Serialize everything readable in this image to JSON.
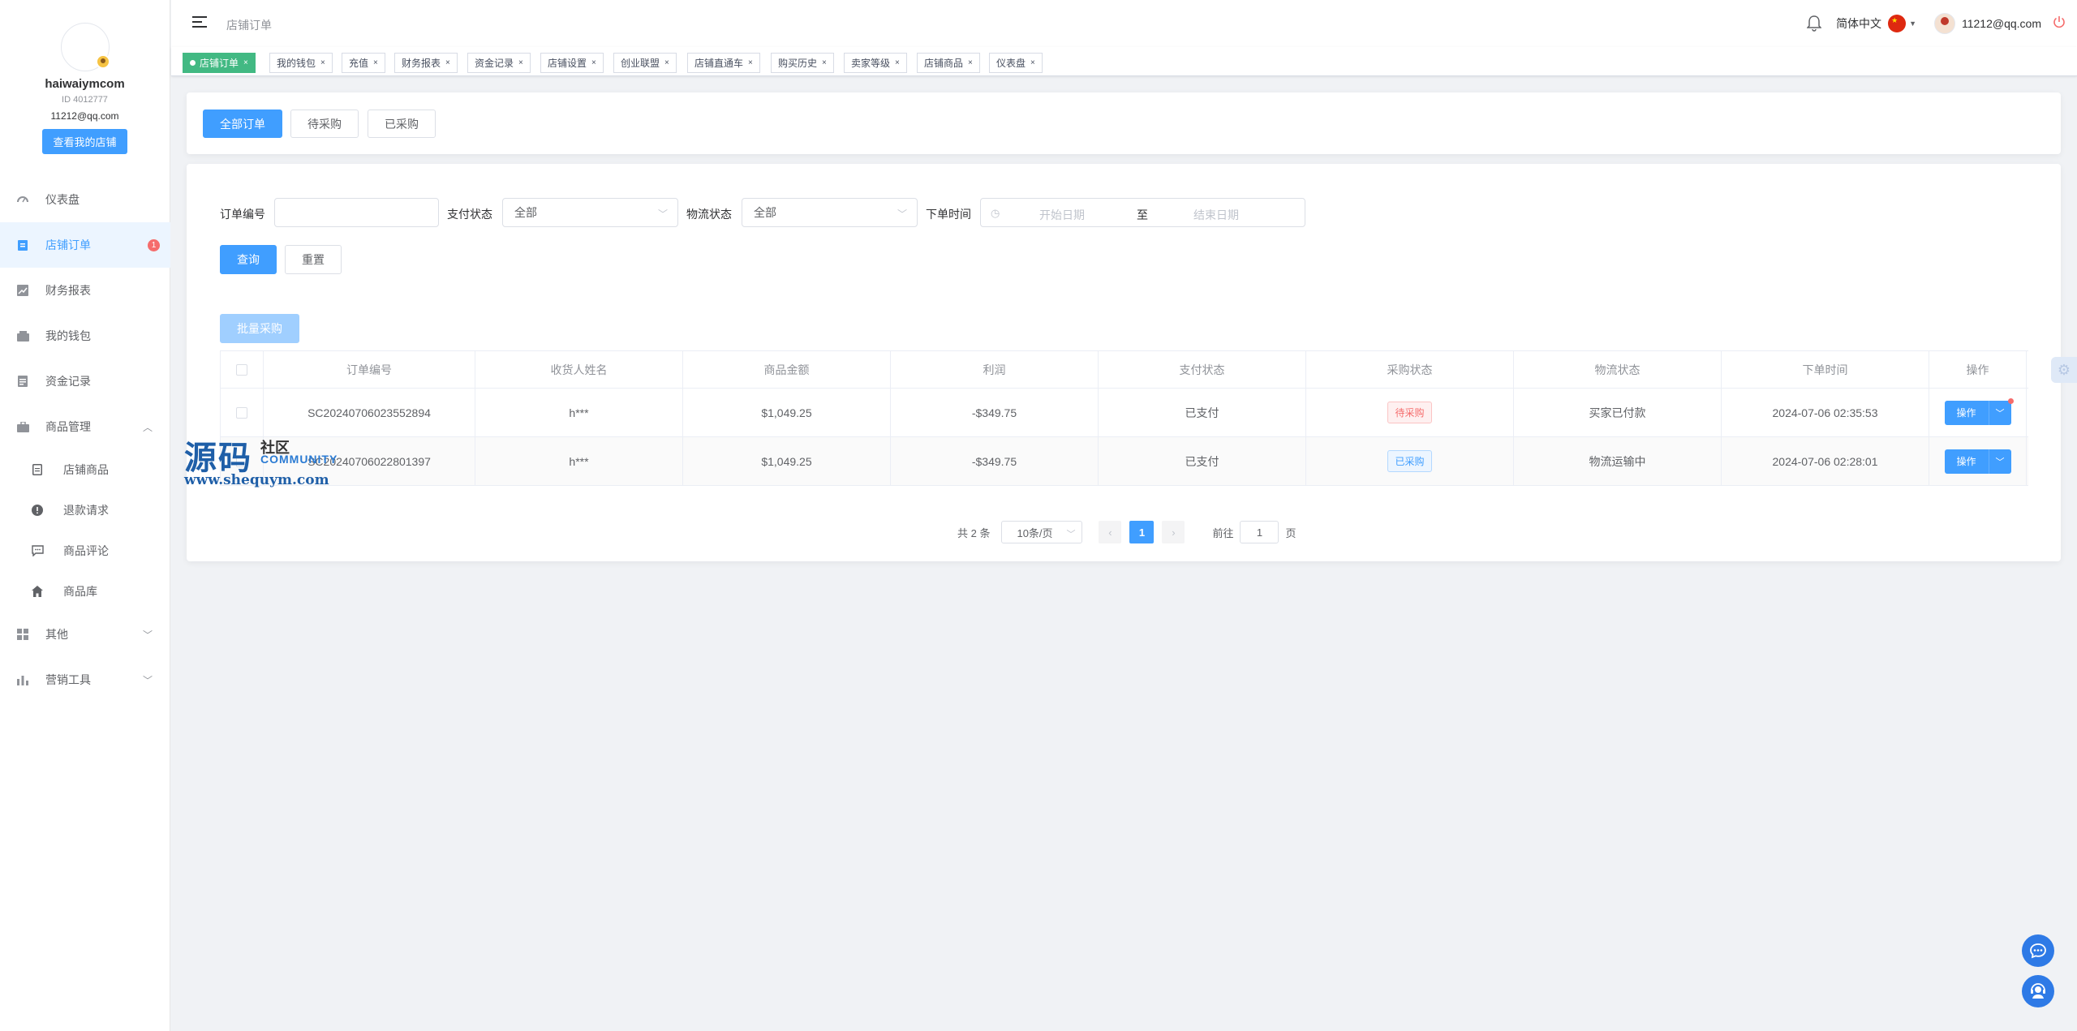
{
  "profile": {
    "name": "haiwaiymcom",
    "uid": "ID 4012777",
    "email": "11212@qq.com",
    "view_store": "查看我的店铺"
  },
  "nav": {
    "dashboard": "仪表盘",
    "store_orders": "店铺订单",
    "store_orders_badge": "1",
    "finance": "财务报表",
    "wallet": "我的钱包",
    "funds": "资金记录",
    "products": "商品管理",
    "store_products": "店铺商品",
    "refunds": "退款请求",
    "reviews": "商品评论",
    "library": "商品库",
    "others": "其他",
    "marketing": "营销工具"
  },
  "header": {
    "breadcrumb": "店铺订单",
    "language": "简体中文",
    "user_email": "11212@qq.com"
  },
  "tags": [
    {
      "label": "店铺订单"
    },
    {
      "label": "我的钱包"
    },
    {
      "label": "充值"
    },
    {
      "label": "财务报表"
    },
    {
      "label": "资金记录"
    },
    {
      "label": "店铺设置"
    },
    {
      "label": "创业联盟"
    },
    {
      "label": "店铺直通车"
    },
    {
      "label": "购买历史"
    },
    {
      "label": "卖家等级"
    },
    {
      "label": "店铺商品"
    },
    {
      "label": "仪表盘"
    }
  ],
  "tag_close": "×",
  "order_tabs": {
    "all": "全部订单",
    "pending": "待采购",
    "purchased": "已采购"
  },
  "filters": {
    "order_no_label": "订单编号",
    "order_no_value": "",
    "pay_status_label": "支付状态",
    "pay_status_value": "全部",
    "logistics_label": "物流状态",
    "logistics_value": "全部",
    "order_time_label": "下单时间",
    "start_placeholder": "开始日期",
    "range_sep": "至",
    "end_placeholder": "结束日期",
    "query": "查询",
    "reset": "重置",
    "batch_purchase": "批量采购"
  },
  "table": {
    "headers": [
      "订单编号",
      "收货人姓名",
      "商品金额",
      "利润",
      "支付状态",
      "采购状态",
      "物流状态",
      "下单时间",
      "操作"
    ],
    "rows": [
      {
        "order_no": "SC20240706023552894",
        "receiver": "h***",
        "amount": "$1,049.25",
        "profit": "-$349.75",
        "pay_status": "已支付",
        "purchase_status": "待采购",
        "logistics": "买家已付款",
        "time": "2024-07-06 02:35:53",
        "action": "操作"
      },
      {
        "order_no": "SC20240706022801397",
        "receiver": "h***",
        "amount": "$1,049.25",
        "profit": "-$349.75",
        "pay_status": "已支付",
        "purchase_status": "已采购",
        "logistics": "物流运输中",
        "time": "2024-07-06 02:28:01",
        "action": "操作"
      }
    ]
  },
  "pagination": {
    "total": "共 2 条",
    "page_size": "10条/页",
    "current": "1",
    "goto_label": "前往",
    "goto_value": "1",
    "page_unit": "页"
  },
  "watermark": {
    "big": "源码",
    "small": "社区",
    "community": "COMMUNITY",
    "url": "www.shequym.com"
  },
  "colors": {
    "primary": "#409eff",
    "active_tag": "#42b983",
    "danger": "#f56c6c"
  }
}
